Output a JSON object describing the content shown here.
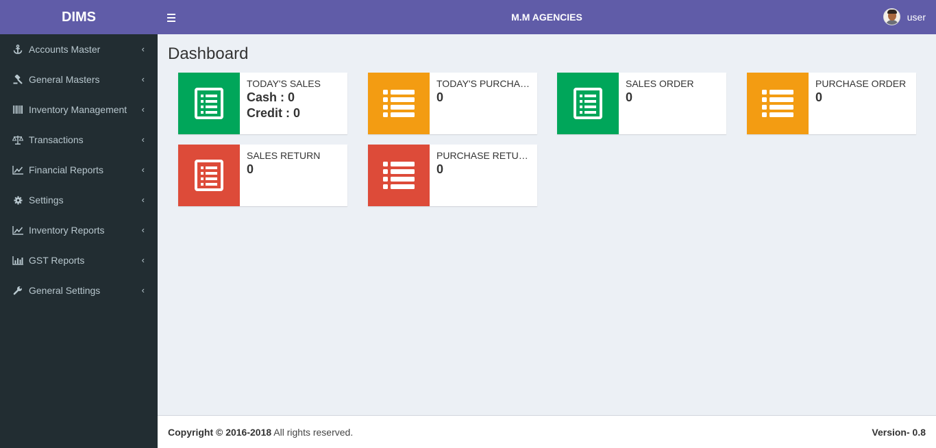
{
  "app": {
    "logo": "DIMS",
    "company": "M.M AGENCIES",
    "user": "user"
  },
  "colors": {
    "header": "#605ca8",
    "sidebar": "#222d32",
    "green": "#00a65a",
    "orange": "#f39c12",
    "red": "#dd4b39"
  },
  "sidebar": {
    "items": [
      {
        "label": "Accounts Master",
        "icon": "anchor-icon"
      },
      {
        "label": "General Masters",
        "icon": "gavel-icon"
      },
      {
        "label": "Inventory Management",
        "icon": "barcode-icon"
      },
      {
        "label": "Transactions",
        "icon": "balance-scale-icon"
      },
      {
        "label": "Financial Reports",
        "icon": "line-chart-icon"
      },
      {
        "label": "Settings",
        "icon": "cog-icon"
      },
      {
        "label": "Inventory Reports",
        "icon": "line-chart-icon"
      },
      {
        "label": "GST Reports",
        "icon": "bar-chart-icon"
      },
      {
        "label": "General Settings",
        "icon": "wrench-icon"
      }
    ]
  },
  "main": {
    "title": "Dashboard",
    "boxes": [
      {
        "label": "TODAY'S SALES",
        "cash": "Cash : 0",
        "credit": "Credit : 0",
        "color": "green",
        "icon": "list-alt-icon"
      },
      {
        "label": "TODAY'S PURCHASE",
        "value": "0",
        "color": "orange",
        "icon": "list-icon"
      },
      {
        "label": "SALES ORDER",
        "value": "0",
        "color": "green",
        "icon": "list-alt-icon"
      },
      {
        "label": "PURCHASE ORDER",
        "value": "0",
        "color": "orange",
        "icon": "list-icon"
      },
      {
        "label": "SALES RETURN",
        "value": "0",
        "color": "red",
        "icon": "list-alt-icon"
      },
      {
        "label": "PURCHASE RETURN",
        "value": "0",
        "color": "red",
        "icon": "list-icon"
      }
    ]
  },
  "footer": {
    "copyright": "Copyright © 2016-2018",
    "rights": " All rights reserved.",
    "version": "Version- 0.8"
  }
}
